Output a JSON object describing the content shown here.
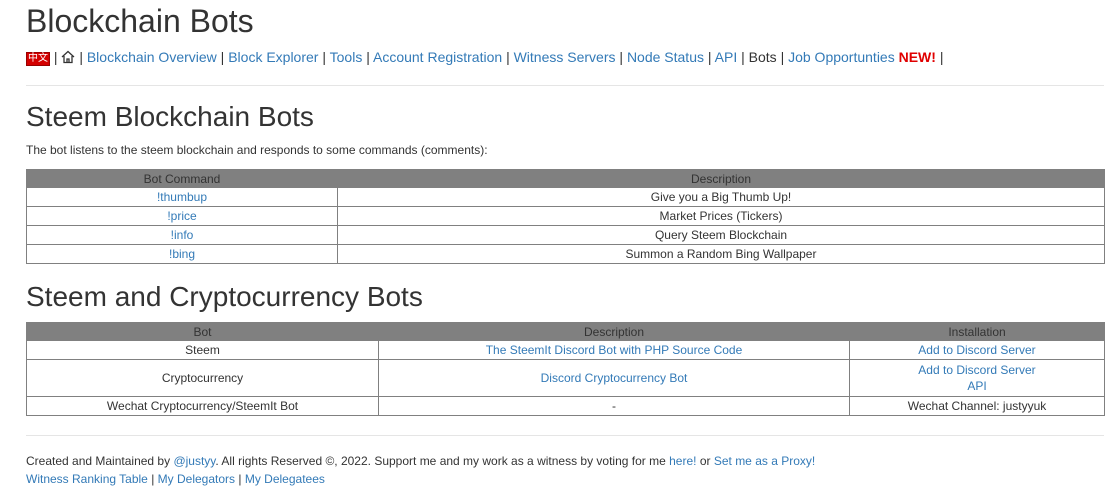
{
  "header": {
    "title": "Blockchain Bots",
    "lang_label": "中文",
    "nav_links": [
      "Blockchain Overview",
      "Block Explorer",
      "Tools",
      "Account Registration",
      "Witness Servers",
      "Node Status",
      "API"
    ],
    "current": "Bots",
    "jobs": "Job Opportunties",
    "new_badge": "NEW!"
  },
  "steem_bots": {
    "heading": "Steem Blockchain Bots",
    "intro": "The bot listens to the steem blockchain and responds to some commands (comments):",
    "columns": [
      "Bot Command",
      "Description"
    ],
    "rows": [
      {
        "command": "!thumbup",
        "description": "Give you a Big Thumb Up!"
      },
      {
        "command": "!price",
        "description": "Market Prices (Tickers)"
      },
      {
        "command": "!info",
        "description": "Query Steem Blockchain"
      },
      {
        "command": "!bing",
        "description": "Summon a Random Bing Wallpaper"
      }
    ]
  },
  "crypto_bots": {
    "heading": "Steem and Cryptocurrency Bots",
    "columns": [
      "Bot",
      "Description",
      "Installation"
    ],
    "rows": [
      {
        "bot": "Steem",
        "description": "The SteemIt Discord Bot with PHP Source Code",
        "install": "Add to Discord Server",
        "install2": ""
      },
      {
        "bot": "Cryptocurrency",
        "description": "Discord Cryptocurrency Bot",
        "install": "Add to Discord Server",
        "install2": "API"
      },
      {
        "bot": "Wechat Cryptocurrency/SteemIt Bot",
        "description": "-",
        "install": "Wechat Channel: justyyuk",
        "install2": ""
      }
    ]
  },
  "footer": {
    "created": "Created and Maintained by",
    "author": "@justyy",
    "rights": ". All rights Reserved ©, 2022. Support me and my work as a witness by voting for me",
    "here": "here!",
    "or": "or",
    "proxy": "Set me as a Proxy!",
    "links": [
      "Witness Ranking Table",
      "My Delegators",
      "My Delegatees"
    ]
  },
  "colors": {
    "link": "#337ab7",
    "header_bg": "#808080",
    "new": "#e00000"
  }
}
